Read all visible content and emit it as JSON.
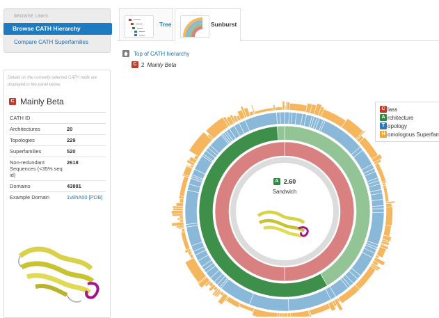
{
  "sidebar": {
    "links_heading": "BROWSE LINKS",
    "links": [
      {
        "label": "Browse CATH Hierarchy",
        "active": true
      },
      {
        "label": "Compare CATH Superfamilies",
        "active": false
      }
    ],
    "node_description": "Details on the currently selected CATH node are displayed in the panel below.",
    "node": {
      "badge": "C",
      "title": "Mainly Beta",
      "stats": [
        {
          "label": "CATH ID",
          "value": ""
        },
        {
          "label": "Architectures",
          "value": "20"
        },
        {
          "label": "Topologies",
          "value": "229"
        },
        {
          "label": "Superfamilies",
          "value": "520"
        },
        {
          "label": "Non-redundant Sequences (<35% seq id)",
          "value": "2618"
        },
        {
          "label": "Domains",
          "value": "43881"
        },
        {
          "label": "Example Domain",
          "value": "1v8hA00 [PDB]",
          "is_link": true
        }
      ]
    }
  },
  "tabs": [
    {
      "label": "Tree",
      "active": false
    },
    {
      "label": "Sunburst",
      "active": true
    }
  ],
  "breadcrumb": {
    "root": "Top of CATH hierarchy",
    "current_badge": "C",
    "current_number": "2",
    "current_name": "Mainly Beta"
  },
  "legend": {
    "items": [
      {
        "badge": "C",
        "text": "lass",
        "color": "#c0392b"
      },
      {
        "badge": "A",
        "text": "rchitecture",
        "color": "#2e8b3e"
      },
      {
        "badge": "T",
        "text": "opology",
        "color": "#3178b8"
      },
      {
        "badge": "H",
        "text": "omologous Superfamily",
        "color": "#f0a63c"
      }
    ]
  },
  "center": {
    "badge": "A",
    "code": "2.60",
    "name": "Sandwich"
  },
  "colors": {
    "class": "#d98080",
    "architecture_selected": "#3d8f4a",
    "architecture": "#93c495",
    "topology": "#8ab8d8",
    "superfamily": "#f5b65e",
    "accent": "#1f7bbf"
  }
}
